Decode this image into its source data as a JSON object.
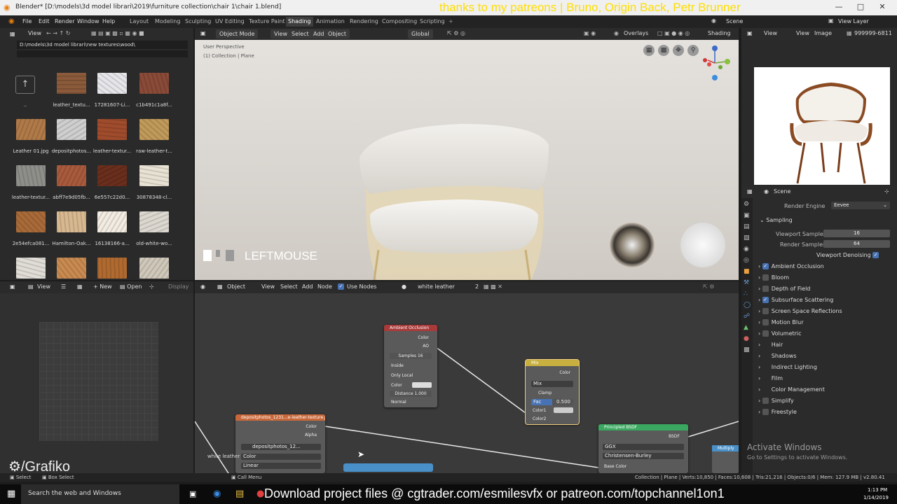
{
  "titlebar": {
    "title": "Blender* [D:\\models\\3d model librari\\2019\\furniture collection\\chair 1\\chair 1.blend]",
    "patreon_text": "thanks to my patreons | Bruno, Origin Back, Petr Brunner"
  },
  "menubar": {
    "menus": [
      "File",
      "Edit",
      "Render",
      "Window",
      "Help"
    ],
    "workspaces": [
      "Layout",
      "Modeling",
      "Sculpting",
      "UV Editing",
      "Texture Paint",
      "Shading",
      "Animation",
      "Rendering",
      "Compositing",
      "Scripting"
    ],
    "active_workspace": "Shading",
    "scene_label": "Scene",
    "view_layer_label": "View Layer"
  },
  "filebrowser": {
    "view_menu": "View",
    "path": "D:\\models\\3d model librari\\new textures\\wood\\",
    "parent_label": "..",
    "files": [
      {
        "name": "leather_textu...",
        "color": "#8a5a3a"
      },
      {
        "name": "17281607-Li...",
        "color": "#e6e6ea"
      },
      {
        "name": "c1b491c1a8f...",
        "color": "#8a4a38"
      },
      {
        "name": "Leather 01.jpg",
        "color": "#b07a48"
      },
      {
        "name": "depositphotos...",
        "color": "#cfcfcf"
      },
      {
        "name": "leather-textur...",
        "color": "#a04c2c"
      },
      {
        "name": "raw-leather-t...",
        "color": "#c09a5a"
      },
      {
        "name": "leather-textur...",
        "color": "#8e8e8a"
      },
      {
        "name": "abff7e9d05fb...",
        "color": "#a85a3c"
      },
      {
        "name": "6e557c22d0...",
        "color": "#6a2e1c"
      },
      {
        "name": "30878348-cl...",
        "color": "#e8e2d4"
      },
      {
        "name": "2e54efca081...",
        "color": "#a86a38"
      },
      {
        "name": "Hamilton-Oak...",
        "color": "#d8b890"
      },
      {
        "name": "16138166-a...",
        "color": "#f2ece2"
      },
      {
        "name": "old-white-wo...",
        "color": "#dcd8d0"
      },
      {
        "name": "",
        "color": "#e0dcd6"
      },
      {
        "name": "",
        "color": "#c88a50"
      },
      {
        "name": "",
        "color": "#b06a30"
      },
      {
        "name": "",
        "color": "#cfc8ba"
      }
    ]
  },
  "viewport": {
    "mode": "Object Mode",
    "menus": [
      "View",
      "Select",
      "Add",
      "Object"
    ],
    "transform": "Global",
    "overlays": "Overlays",
    "shading": "Shading",
    "perspective": "User Perspective",
    "collection": "(1) Collection | Plane",
    "key_overlay": "LEFTMOUSE"
  },
  "imageeditor": {
    "menus": [
      "View",
      "View",
      "Image"
    ],
    "name": "999999-6811"
  },
  "properties": {
    "scene": "Scene",
    "render_engine_label": "Render Engine",
    "render_engine": "Eevee",
    "sampling": "Sampling",
    "viewport_samples_label": "Viewport Samples",
    "viewport_samples": "16",
    "render_samples_label": "Render Samples",
    "render_samples": "64",
    "viewport_denoising": "Viewport Denoising",
    "panels": [
      {
        "label": "Ambient Occlusion",
        "checkbox": true,
        "checked": true
      },
      {
        "label": "Bloom",
        "checkbox": true,
        "checked": false
      },
      {
        "label": "Depth of Field",
        "checkbox": true,
        "checked": false
      },
      {
        "label": "Subsurface Scattering",
        "checkbox": true,
        "checked": true
      },
      {
        "label": "Screen Space Reflections",
        "checkbox": true,
        "checked": false
      },
      {
        "label": "Motion Blur",
        "checkbox": true,
        "checked": false
      },
      {
        "label": "Volumetric",
        "checkbox": true,
        "checked": false
      },
      {
        "label": "Hair",
        "checkbox": false,
        "checked": false
      },
      {
        "label": "Shadows",
        "checkbox": false,
        "checked": false
      },
      {
        "label": "Indirect Lighting",
        "checkbox": false,
        "checked": false
      },
      {
        "label": "Film",
        "checkbox": false,
        "checked": false
      },
      {
        "label": "Color Management",
        "checkbox": false,
        "checked": false
      },
      {
        "label": "Simplify",
        "checkbox": true,
        "checked": false
      },
      {
        "label": "Freestyle",
        "checkbox": true,
        "checked": false
      }
    ]
  },
  "leftbottom": {
    "view": "View",
    "new": "New",
    "open": "Open",
    "display": "Display"
  },
  "nodeeditor": {
    "object": "Object",
    "menus": [
      "View",
      "Select",
      "Add",
      "Node"
    ],
    "use_nodes": "Use Nodes",
    "material": "white leather",
    "users": "2",
    "ao_node": {
      "title": "Ambient Occlusion",
      "color_out": "Color",
      "ao_out": "AO",
      "samples_label": "Samples",
      "samples": "16",
      "inside": "Inside",
      "only_local": "Only Local",
      "color_in": "Color",
      "distance_label": "Distance",
      "distance": "1.000",
      "normal": "Normal"
    },
    "mix_node": {
      "title": "Mix",
      "color_out": "Color",
      "blend": "Mix",
      "clamp": "Clamp",
      "fac_label": "Fac",
      "fac": "0.500",
      "color1": "Color1",
      "color2": "Color2"
    },
    "tex_node": {
      "title": "depositphotos_1231...e-leather-texture.jpg",
      "color": "Color",
      "alpha": "Alpha",
      "image": "depositphotos_12...",
      "colorspace": "Color",
      "interp": "Linear"
    },
    "bsdf_node": {
      "title": "Principled BSDF",
      "bsdf_out": "BSDF",
      "dist": "GGX",
      "sss": "Christensen-Burley",
      "base_color": "Base Color"
    },
    "frame_label": "white leather",
    "multiply_label": "Multiply",
    "activate_title": "Activate Windows",
    "activate_sub": "Go to Settings to activate Windows."
  },
  "watermark": "/Grafiko",
  "statusbar": {
    "select": "Select",
    "box_select": "Box Select",
    "call_menu": "Call Menu",
    "stats": "Collection | Plane | Verts:10,850 | Faces:10,608 | Tris:21,216 | Objects:0/6 | Mem: 127.9 MB | v2.80.41"
  },
  "taskbar": {
    "search": "Search the web and Windows",
    "banner": "Download project files @ cgtrader.com/esmilesvfx or patreon.com/topchannel1on1",
    "time": "1:13 PM",
    "date": "1/14/2019"
  }
}
